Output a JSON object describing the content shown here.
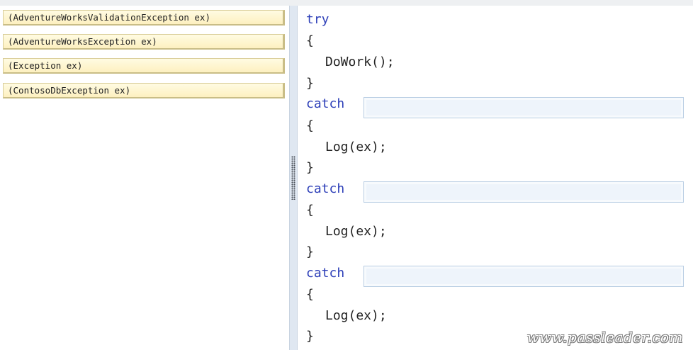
{
  "choices": [
    {
      "label": "(AdventureWorksValidationException ex)"
    },
    {
      "label": "(AdventureWorksException ex)"
    },
    {
      "label": "(Exception ex)"
    },
    {
      "label": "(ContosoDbException ex)"
    }
  ],
  "code": {
    "try_keyword": "try",
    "open_brace": "{",
    "close_brace": "}",
    "try_body": "DoWork();",
    "catch_keyword": "catch",
    "catch_body": "Log(ex);"
  },
  "watermark": "www.passleader.com",
  "colors": {
    "keyword": "#2d3fb8",
    "choice_bg": "#fdf0c0",
    "drop_target_bg": "#eef4fb"
  }
}
